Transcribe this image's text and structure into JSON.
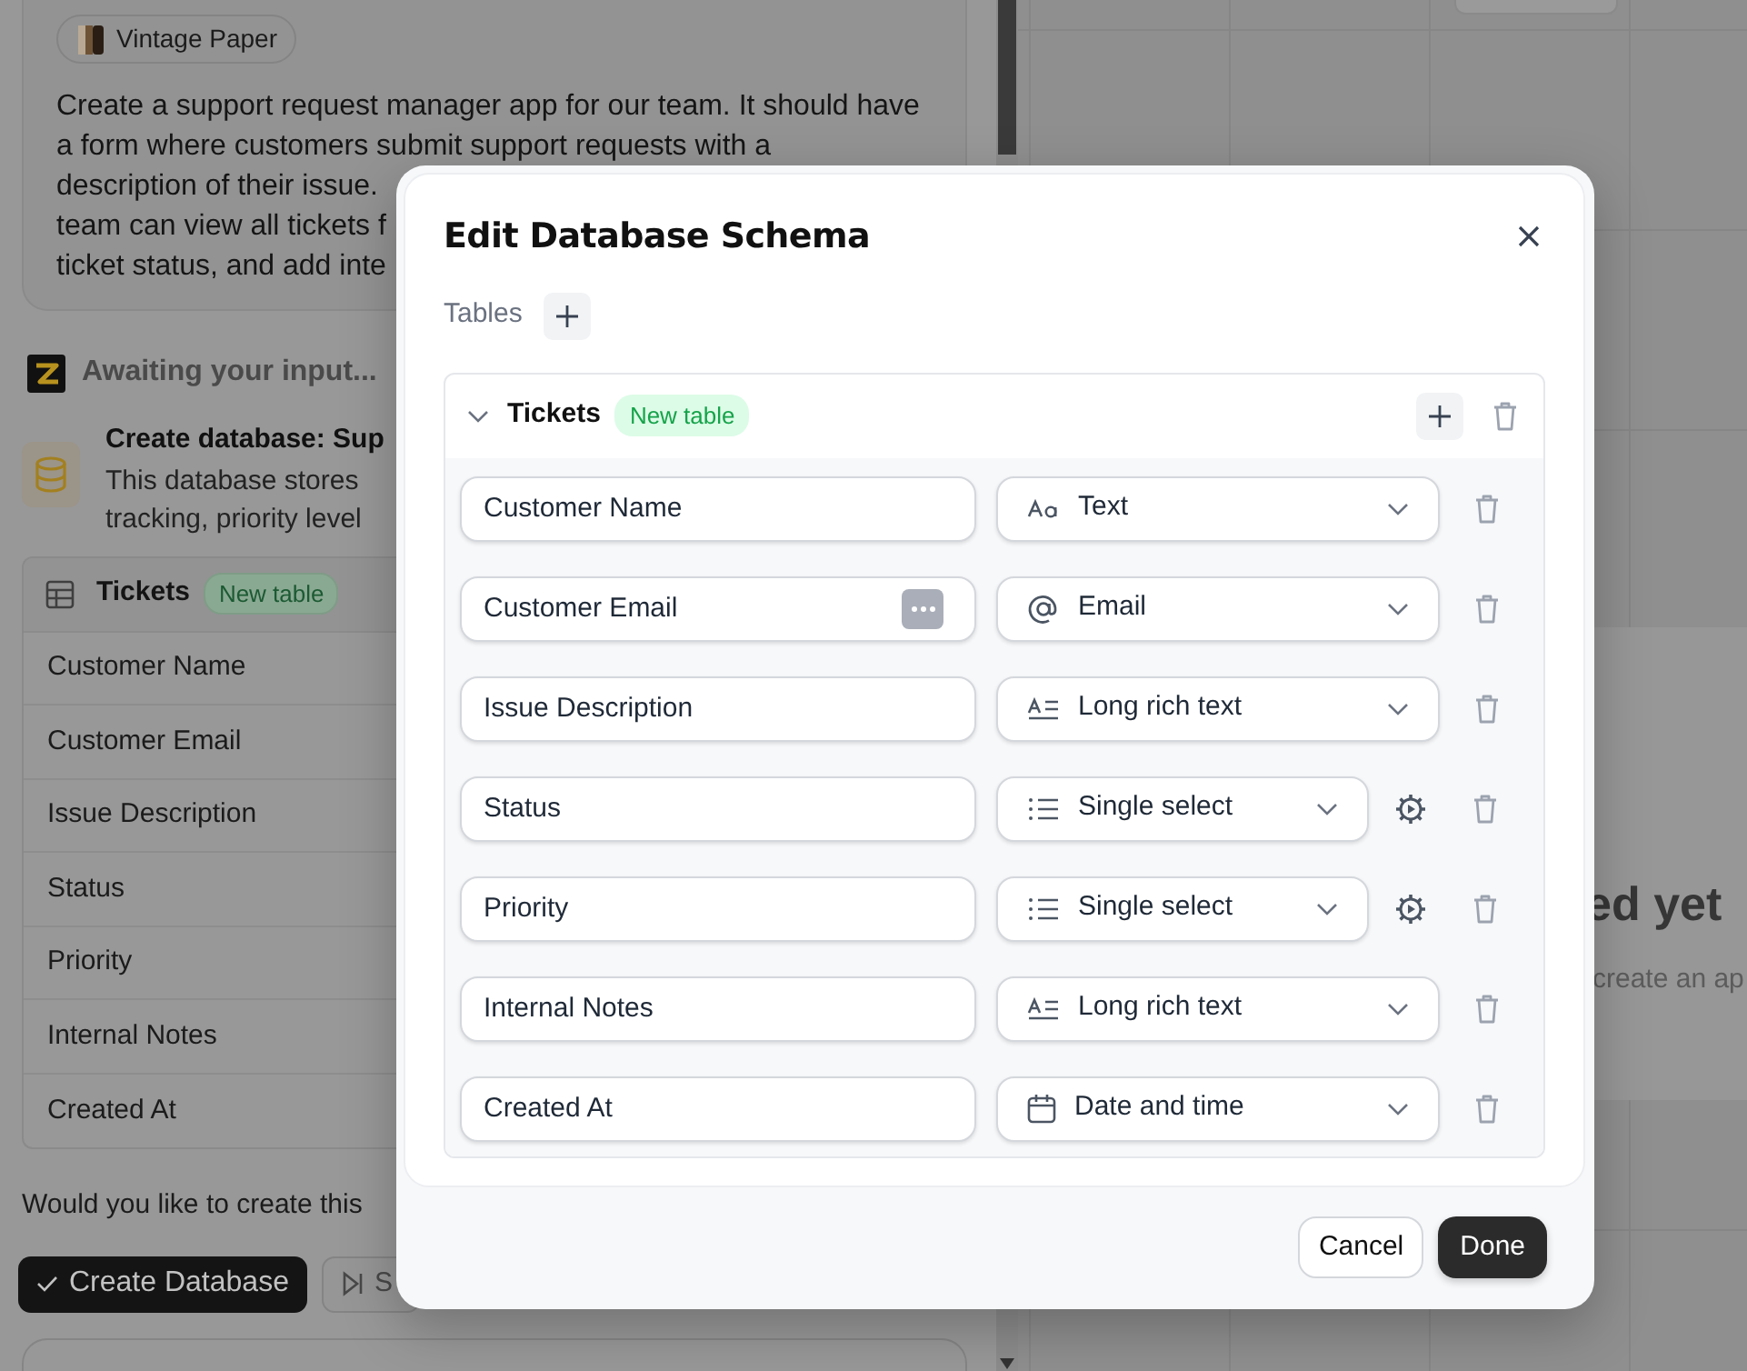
{
  "background": {
    "theme_chip": "Vintage Paper",
    "prompt_lines": [
      "Create a support request manager app for our team. It should have",
      "a form where customers submit support requests with a",
      "description of their issue.",
      "team can view all tickets f",
      "ticket status, and add inte"
    ],
    "status": "Awaiting your input...",
    "action": {
      "title": "Create database: Sup",
      "description_lines": [
        "This database stores",
        "tracking, priority level"
      ]
    },
    "table": {
      "name": "Tickets",
      "badge": "New table",
      "fields": [
        "Customer Name",
        "Customer Email",
        "Issue Description",
        "Status",
        "Priority",
        "Internal Notes",
        "Created At"
      ]
    },
    "question": "Would you like to create this",
    "buttons": [
      {
        "label": "Create Database",
        "kind": "primary"
      },
      {
        "label": "S",
        "kind": "skip"
      }
    ],
    "canvas": {
      "heading": "ed yet",
      "text": "create an ap"
    }
  },
  "dialog": {
    "title": "Edit Database Schema",
    "tables_label": "Tables",
    "tables": [
      {
        "name": "Tickets",
        "badge": "New table",
        "expanded": true,
        "fields": [
          {
            "name": "Customer Name",
            "type": "Text",
            "kind": "text",
            "configurable": false,
            "autofill_icon": false
          },
          {
            "name": "Customer Email",
            "type": "Email",
            "kind": "email",
            "configurable": false,
            "autofill_icon": true
          },
          {
            "name": "Issue Description",
            "type": "Long rich text",
            "kind": "long_text",
            "configurable": false,
            "autofill_icon": false
          },
          {
            "name": "Status",
            "type": "Single select",
            "kind": "select",
            "configurable": true,
            "autofill_icon": false
          },
          {
            "name": "Priority",
            "type": "Single select",
            "kind": "select",
            "configurable": true,
            "autofill_icon": false
          },
          {
            "name": "Internal Notes",
            "type": "Long rich text",
            "kind": "long_text",
            "configurable": false,
            "autofill_icon": false
          },
          {
            "name": "Created At",
            "type": "Date and time",
            "kind": "datetime",
            "configurable": false,
            "autofill_icon": false
          }
        ]
      }
    ],
    "buttons": [
      {
        "label": "Cancel",
        "kind": "secondary"
      },
      {
        "label": "Done",
        "kind": "primary"
      }
    ]
  }
}
